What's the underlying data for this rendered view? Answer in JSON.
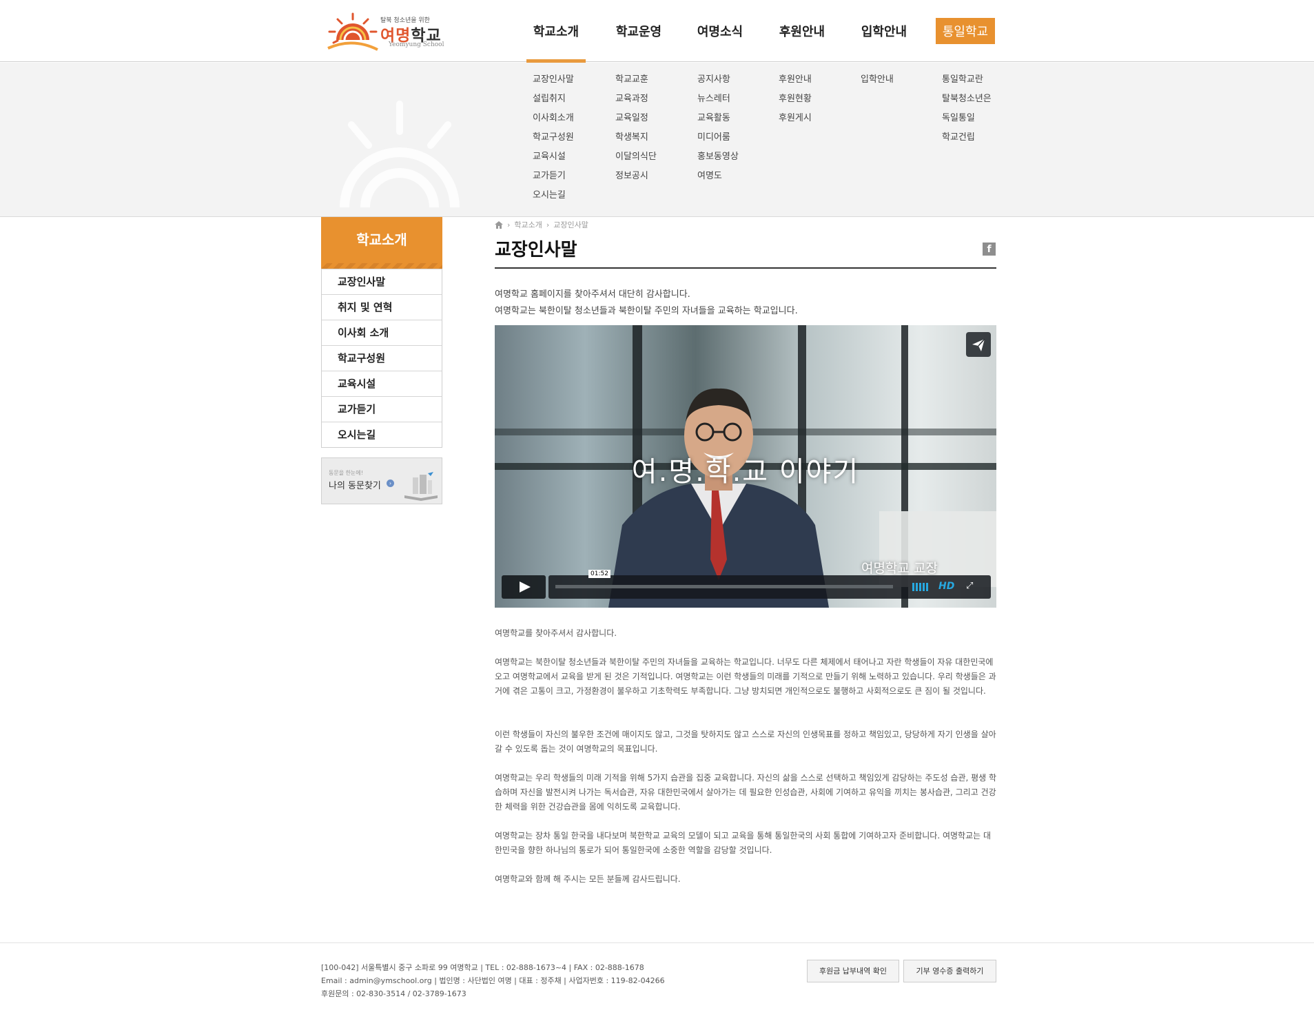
{
  "brand": {
    "tagline": "탈북 청소년을 위한",
    "name_part1": "여명",
    "name_part2": "학교",
    "english": "Yeomyung School"
  },
  "gnb": [
    {
      "label": "학교소개"
    },
    {
      "label": "학교운영"
    },
    {
      "label": "여명소식"
    },
    {
      "label": "후원안내"
    },
    {
      "label": "입학안내"
    },
    {
      "label": "통일학교"
    }
  ],
  "submenu": [
    [
      "교장인사말",
      "설립취지",
      "이사회소개",
      "학교구성원",
      "교육시설",
      "교가듣기",
      "오시는길"
    ],
    [
      "학교교훈",
      "교육과정",
      "교육일정",
      "학생복지",
      "이달의식단",
      "정보공시"
    ],
    [
      "공지사항",
      "뉴스레터",
      "교육활동",
      "미디어룸",
      "홍보동영상",
      "여명도"
    ],
    [
      "후원안내",
      "후원현황",
      "후원게시"
    ],
    [
      "입학안내"
    ],
    [
      "통일학교란",
      "탈북청소년은",
      "독일통일",
      "학교건립"
    ]
  ],
  "sidebar": {
    "title": "학교소개",
    "items": [
      "교장인사말",
      "취지 및 연혁",
      "이사회 소개",
      "학교구성원",
      "교육시설",
      "교가듣기",
      "오시는길"
    ],
    "banner_small": "동문을 한눈에!",
    "banner_big": "나의 동문찾기"
  },
  "breadcrumb": [
    "학교소개",
    "교장인사말"
  ],
  "page": {
    "title": "교장인사말",
    "intro1": "여명학교 홈페이지를 찾아주셔서 대단히 감사합니다.",
    "intro2": "여명학교는 북한이탈 청소년들과 북한이탈 주민의 자녀들을 교육하는 학교입니다."
  },
  "video": {
    "title": "여.명.학.교  이야기",
    "subtitle": "여명학교 교장",
    "timecode": "01:52",
    "hd_label": "HD"
  },
  "body": [
    "여명학교를 찾아주셔서 감사합니다.",
    "여명학교는 북한이탈 청소년들과 북한이탈 주민의 자녀들을 교육하는 학교입니다. 너무도 다른 체제에서 태어나고 자란 학생들이 자유 대한민국에 오고 여명학교에서 교육을 받게 된 것은 기적입니다. 여명학교는 이런 학생들의 미래를 기적으로 만들기 위해 노력하고 있습니다. 우리 학생들은 과거에 겪은 고통이 크고, 가정환경이 불우하고 기초학력도 부족합니다. 그냥 방치되면 개인적으로도 불행하고 사회적으로도 큰 짐이 될 것입니다.",
    "이런 학생들이 자신의 불우한 조건에 매이지도 않고, 그것을 탓하지도 않고 스스로 자신의 인생목표를 정하고 책임있고, 당당하게 자기 인생을 살아갈 수 있도록 돕는 것이 여명학교의 목표입니다.",
    "여명학교는 우리 학생들의 미래 기적을 위해 5가지 습관을 집중 교육합니다. 자신의 삶을 스스로 선택하고 책임있게 감당하는 주도성 습관, 평생 학습하며 자신을 발전시켜 나가는 독서습관, 자유 대한민국에서 살아가는 데 필요한 인성습관, 사회에 기여하고 유익을 끼치는 봉사습관, 그리고 건강한 체력을 위한 건강습관을 몸에 익히도록 교육합니다.",
    "여명학교는 장차 통일 한국을 내다보며 북한학교 교육의 모델이 되고 교육을 통해 통일한국의 사회 통합에 기여하고자 준비합니다. 여명학교는 대한민국을 향한 하나님의 통로가 되어 통일한국에 소중한 역할을 감당할 것입니다.",
    "여명학교와 함께 해 주시는 모든 분들께 감사드립니다."
  ],
  "footer": {
    "line1": "[100-042] 서울특별시 중구 소파로 99 여명학교 | TEL : 02-888-1673~4 | FAX : 02-888-1678",
    "line2": "Email : admin@ymschool.org | 법인명 : 사단법인 여명 | 대표 : 정주채 | 사업자번호 : 119-82-04266",
    "line3": "후원문의 : 02-830-3514 / 02-3789-1673",
    "btn1": "후원금 납부내역 확인",
    "btn2": "기부 영수증 출력하기"
  },
  "colors": {
    "accent": "#e8912f",
    "logo_red": "#e0562e",
    "video_ui_blue": "#27a9e1"
  }
}
